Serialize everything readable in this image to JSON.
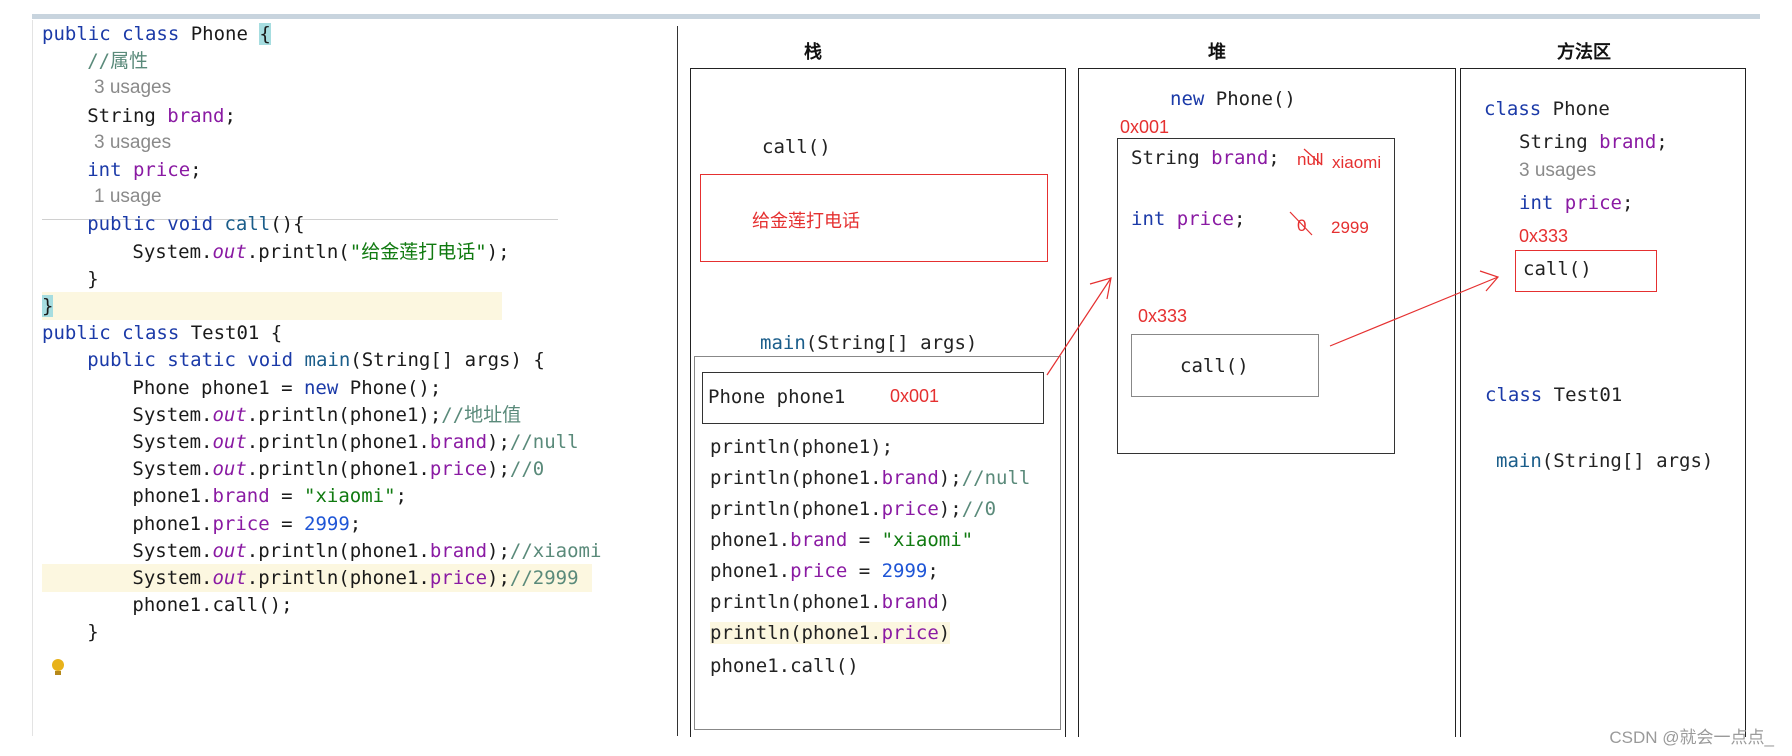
{
  "code_lines": [
    {
      "indent": 0,
      "parts": [
        {
          "t": "public class ",
          "c": "kw"
        },
        {
          "t": "Phone ",
          "c": ""
        },
        {
          "t": "{",
          "c": "brace-hl"
        }
      ]
    },
    {
      "indent": 2,
      "parts": [
        {
          "t": "//属性",
          "c": "cmt"
        }
      ]
    },
    {
      "indent": 2,
      "usage": "3 usages"
    },
    {
      "indent": 2,
      "parts": [
        {
          "t": "String ",
          "c": ""
        },
        {
          "t": "brand",
          "c": "fld"
        },
        {
          "t": ";",
          "c": ""
        }
      ]
    },
    {
      "indent": 2,
      "usage": "3 usages"
    },
    {
      "indent": 2,
      "parts": [
        {
          "t": "int ",
          "c": "kw"
        },
        {
          "t": "price",
          "c": "fld"
        },
        {
          "t": ";",
          "c": ""
        }
      ]
    },
    {
      "indent": 2,
      "usage": "1 usage"
    },
    {
      "indent": 2,
      "parts": [
        {
          "t": "public void ",
          "c": "kw"
        },
        {
          "t": "call",
          "c": "meth"
        },
        {
          "t": "(){",
          "c": ""
        }
      ]
    },
    {
      "indent": 4,
      "parts": [
        {
          "t": "System.",
          "c": ""
        },
        {
          "t": "out",
          "c": "ital"
        },
        {
          "t": ".println(",
          "c": ""
        },
        {
          "t": "\"给金莲打电话\"",
          "c": "str"
        },
        {
          "t": ");",
          "c": ""
        }
      ]
    },
    {
      "indent": 2,
      "parts": [
        {
          "t": "}",
          "c": ""
        }
      ]
    },
    {
      "indent": 0,
      "hl": true,
      "parts": [
        {
          "t": "}",
          "c": "brace-hl"
        }
      ]
    },
    {
      "indent": 0,
      "parts": [
        {
          "t": "public class ",
          "c": "kw"
        },
        {
          "t": "Test01 {",
          "c": ""
        }
      ]
    },
    {
      "indent": 2,
      "parts": [
        {
          "t": "public static void ",
          "c": "kw"
        },
        {
          "t": "main",
          "c": "meth"
        },
        {
          "t": "(String[] args) {",
          "c": ""
        }
      ]
    },
    {
      "indent": 4,
      "parts": [
        {
          "t": "Phone phone1 = ",
          "c": ""
        },
        {
          "t": "new ",
          "c": "kw"
        },
        {
          "t": "Phone();",
          "c": ""
        }
      ]
    },
    {
      "indent": 4,
      "parts": [
        {
          "t": "System.",
          "c": ""
        },
        {
          "t": "out",
          "c": "ital"
        },
        {
          "t": ".println(phone1);",
          "c": ""
        },
        {
          "t": "//地址值",
          "c": "cmt"
        }
      ]
    },
    {
      "indent": 4,
      "parts": [
        {
          "t": "System.",
          "c": ""
        },
        {
          "t": "out",
          "c": "ital"
        },
        {
          "t": ".println(phone1.",
          "c": ""
        },
        {
          "t": "brand",
          "c": "fld"
        },
        {
          "t": ");",
          "c": ""
        },
        {
          "t": "//null",
          "c": "cmt"
        }
      ]
    },
    {
      "indent": 4,
      "parts": [
        {
          "t": "System.",
          "c": ""
        },
        {
          "t": "out",
          "c": "ital"
        },
        {
          "t": ".println(phone1.",
          "c": ""
        },
        {
          "t": "price",
          "c": "fld"
        },
        {
          "t": ");",
          "c": ""
        },
        {
          "t": "//0",
          "c": "cmt"
        }
      ]
    },
    {
      "indent": 4,
      "parts": [
        {
          "t": "phone1.",
          "c": ""
        },
        {
          "t": "brand",
          "c": "fld"
        },
        {
          "t": " = ",
          "c": ""
        },
        {
          "t": "\"xiaomi\"",
          "c": "str"
        },
        {
          "t": ";",
          "c": ""
        }
      ]
    },
    {
      "indent": 4,
      "parts": [
        {
          "t": "phone1.",
          "c": ""
        },
        {
          "t": "price",
          "c": "fld"
        },
        {
          "t": " = ",
          "c": ""
        },
        {
          "t": "2999",
          "c": "num"
        },
        {
          "t": ";",
          "c": ""
        }
      ]
    },
    {
      "indent": 4,
      "parts": [
        {
          "t": "System.",
          "c": ""
        },
        {
          "t": "out",
          "c": "ital"
        },
        {
          "t": ".println(phone1.",
          "c": ""
        },
        {
          "t": "brand",
          "c": "fld"
        },
        {
          "t": ");",
          "c": ""
        },
        {
          "t": "//xiaomi",
          "c": "cmt"
        }
      ]
    },
    {
      "indent": 4,
      "hl": true,
      "parts": [
        {
          "t": "System.",
          "c": ""
        },
        {
          "t": "out",
          "c": "ital"
        },
        {
          "t": ".println(phone1.",
          "c": ""
        },
        {
          "t": "price",
          "c": "fld"
        },
        {
          "t": ");",
          "c": ""
        },
        {
          "t": "//2999",
          "c": "cmt"
        }
      ]
    },
    {
      "indent": 4,
      "parts": [
        {
          "t": "phone1.call();",
          "c": ""
        }
      ]
    },
    {
      "indent": 2,
      "parts": [
        {
          "t": "}",
          "c": ""
        }
      ]
    }
  ],
  "diagram": {
    "headers": {
      "stack": "栈",
      "heap": "堆",
      "method_area": "方法区"
    },
    "stack": {
      "call_frame": "call()",
      "call_output": "给金莲打电话",
      "main_frame": "main(String[] args)",
      "phone_var": "Phone phone1",
      "phone_var_addr": "0x001",
      "statements": [
        [
          {
            "t": "println(phone1);",
            "c": ""
          }
        ],
        [
          {
            "t": "println(phone1.",
            "c": ""
          },
          {
            "t": "brand",
            "c": "fld"
          },
          {
            "t": ");",
            "c": ""
          },
          {
            "t": "//null",
            "c": "cmt"
          }
        ],
        [
          {
            "t": "println(phone1.",
            "c": ""
          },
          {
            "t": "price",
            "c": "fld"
          },
          {
            "t": ");",
            "c": ""
          },
          {
            "t": "//0",
            "c": "cmt"
          }
        ],
        [
          {
            "t": "phone1.",
            "c": ""
          },
          {
            "t": "brand",
            "c": "fld"
          },
          {
            "t": " = ",
            "c": ""
          },
          {
            "t": "\"xiaomi\"",
            "c": "str"
          }
        ],
        [
          {
            "t": "phone1.",
            "c": ""
          },
          {
            "t": "price",
            "c": "fld"
          },
          {
            "t": " = ",
            "c": ""
          },
          {
            "t": "2999",
            "c": "num"
          },
          {
            "t": ";",
            "c": ""
          }
        ],
        [
          {
            "t": "println(phone1.",
            "c": ""
          },
          {
            "t": "brand",
            "c": "fld"
          },
          {
            "t": ")",
            "c": ""
          }
        ],
        [
          {
            "t": "println(phone1.",
            "c": ""
          },
          {
            "t": "price",
            "c": "fld"
          },
          {
            "t": ")",
            "c": ""
          }
        ],
        [
          {
            "t": "phone1.call()",
            "c": ""
          }
        ]
      ]
    },
    "heap": {
      "new_expr_kw": "new",
      "new_expr_rest": "Phone()",
      "obj_addr": "0x001",
      "brand_type": "String",
      "brand_field": "brand",
      "brand_semicolon": ";",
      "brand_old": "null",
      "brand_new": "xiaomi",
      "price_type": "int",
      "price_field": "price",
      "price_semicolon": ";",
      "price_old": "0",
      "price_new": "2999",
      "call_addr": "0x333",
      "call_ref": "call()"
    },
    "method_area": {
      "class_kw": "class",
      "class_name": "Phone",
      "brand_type": "String",
      "brand_field": "brand",
      "brand_semicolon": ";",
      "usages": "3 usages",
      "price_type": "int",
      "price_field": "price",
      "price_semicolon": ";",
      "call_addr": "0x333",
      "call_method": "call()",
      "test_kw": "class",
      "test_name": "Test01",
      "main_method": "main",
      "main_args": "(String[] args)"
    }
  },
  "watermark": "CSDN @就会一点点_",
  "colors": {
    "keyword": "#1b3aa8",
    "field": "#8a1aa3",
    "string": "#107a10",
    "comment": "#5a8a7a",
    "number": "#1e55d6",
    "annotation_red": "#e53030"
  }
}
